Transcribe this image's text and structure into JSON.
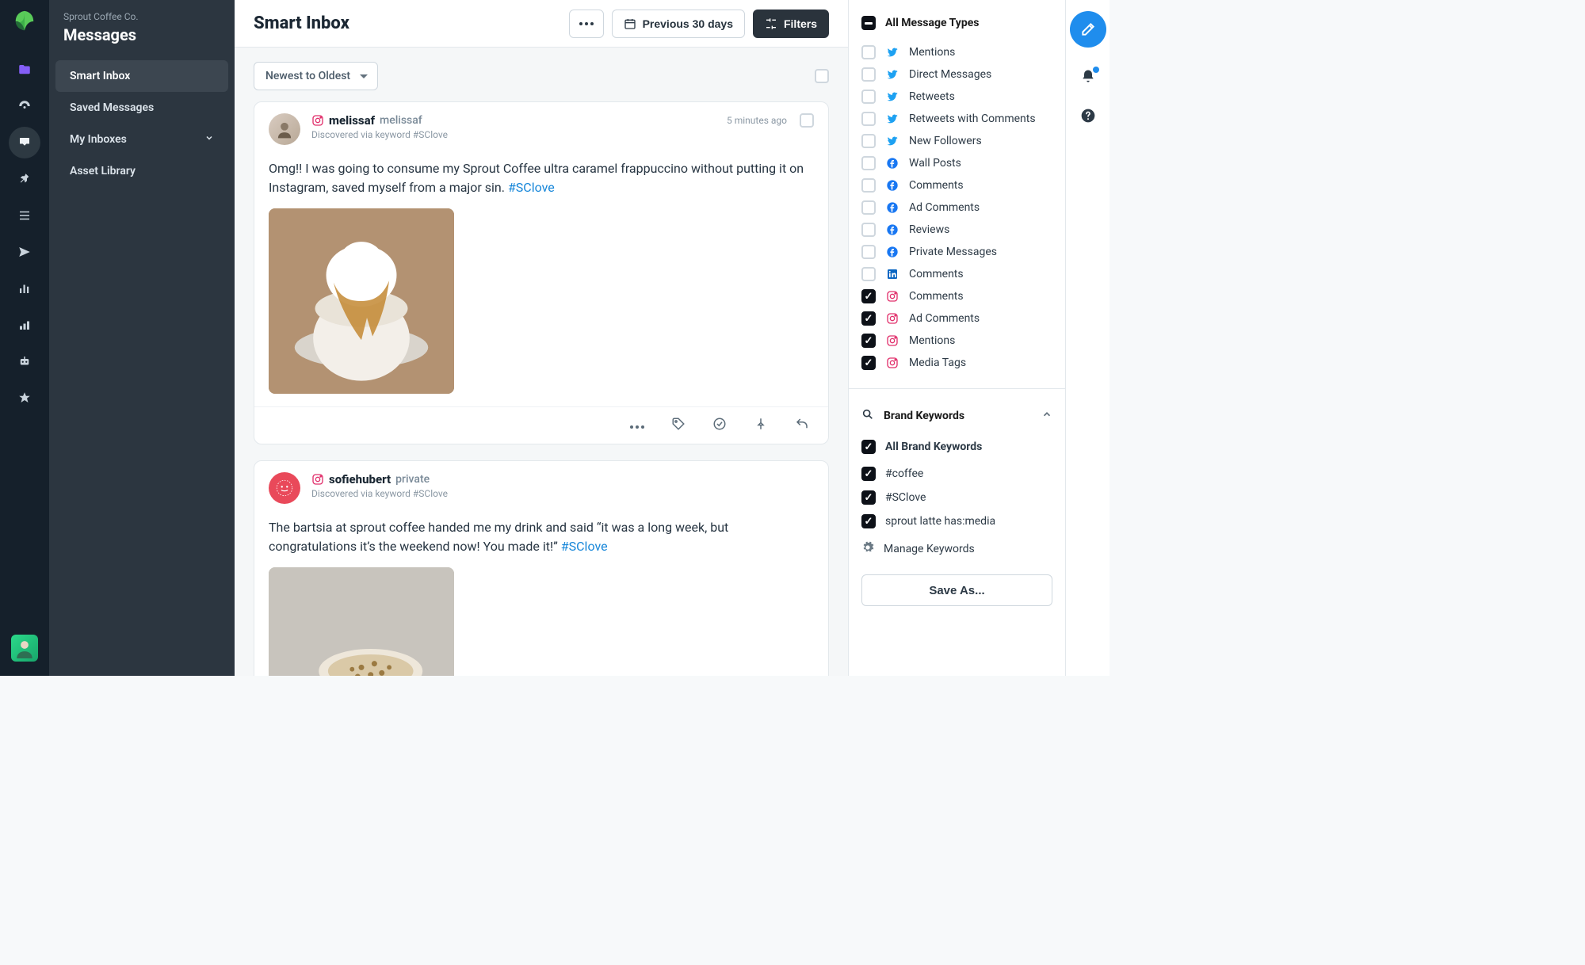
{
  "org": "Sprout Coffee Co.",
  "section": "Messages",
  "sidebar": {
    "items": [
      {
        "label": "Smart Inbox",
        "active": true
      },
      {
        "label": "Saved Messages"
      },
      {
        "label": "My Inboxes",
        "expandable": true
      },
      {
        "label": "Asset Library"
      }
    ]
  },
  "page_title": "Smart Inbox",
  "topbar": {
    "date_range": "Previous 30 days",
    "filters_label": "Filters"
  },
  "sort_label": "Newest to Oldest",
  "messages": [
    {
      "network": "instagram",
      "name": "melissaf",
      "handle": "melissaf",
      "discovered": "Discovered via keyword  #SClove",
      "time": "5 minutes ago",
      "body": "Omg!! I was going to consume my Sprout Coffee ultra caramel frappuccino without putting it on Instagram, saved myself from a major sin. ",
      "hashtag": "#SClove"
    },
    {
      "network": "instagram",
      "name": "sofiehubert",
      "handle": "private",
      "discovered": "Discovered via keyword  #SClove",
      "time": "",
      "body": "The bartsia at sprout coffee handed me my drink and said “it was a long week, but congratulations it’s the weekend now! You made it!” ",
      "hashtag": "#SClove"
    }
  ],
  "filters": {
    "header": "All Message Types",
    "types": [
      {
        "net": "tw",
        "label": "Mentions",
        "checked": false
      },
      {
        "net": "tw",
        "label": "Direct Messages",
        "checked": false
      },
      {
        "net": "tw",
        "label": "Retweets",
        "checked": false
      },
      {
        "net": "tw",
        "label": "Retweets with Comments",
        "checked": false
      },
      {
        "net": "tw",
        "label": "New Followers",
        "checked": false
      },
      {
        "net": "fb",
        "label": "Wall Posts",
        "checked": false
      },
      {
        "net": "fb",
        "label": "Comments",
        "checked": false
      },
      {
        "net": "fb",
        "label": "Ad Comments",
        "checked": false
      },
      {
        "net": "fb",
        "label": "Reviews",
        "checked": false
      },
      {
        "net": "fb",
        "label": "Private Messages",
        "checked": false
      },
      {
        "net": "li",
        "label": "Comments",
        "checked": false
      },
      {
        "net": "ig",
        "label": "Comments",
        "checked": true
      },
      {
        "net": "ig",
        "label": "Ad Comments",
        "checked": true
      },
      {
        "net": "ig",
        "label": "Mentions",
        "checked": true
      },
      {
        "net": "ig",
        "label": "Media Tags",
        "checked": true
      }
    ],
    "brand_header": "Brand Keywords",
    "brand_all": "All Brand Keywords",
    "brand_items": [
      {
        "label": "#coffee",
        "checked": true
      },
      {
        "label": "#SClove",
        "checked": true
      },
      {
        "label": "sprout latte has:media",
        "checked": true
      }
    ],
    "manage_label": "Manage Keywords",
    "save_label": "Save As..."
  }
}
